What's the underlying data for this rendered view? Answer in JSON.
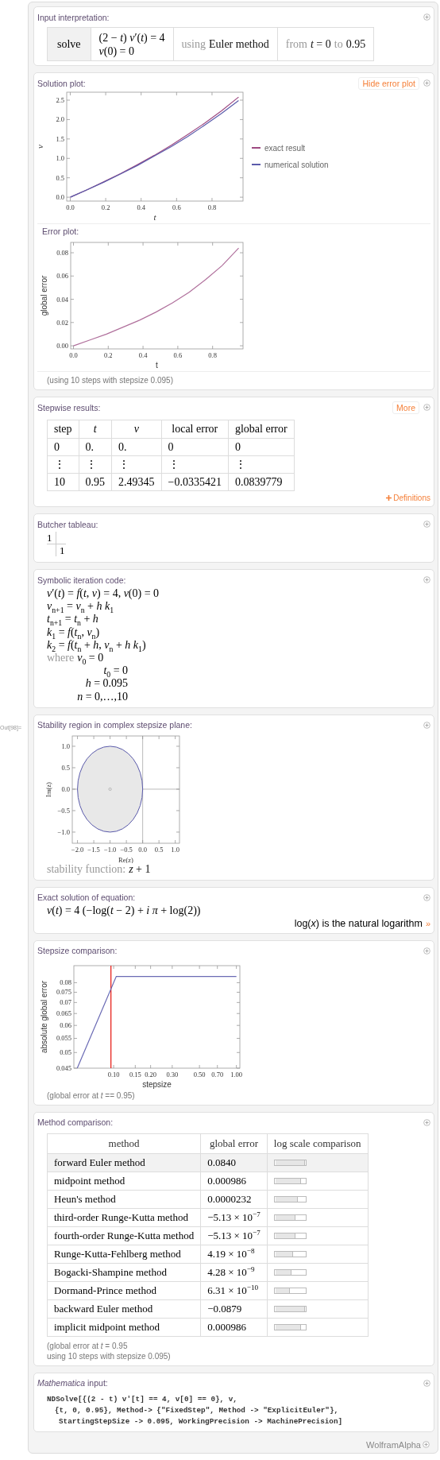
{
  "out_label": "Out[98]=",
  "input_interpretation": {
    "title": "Input interpretation:",
    "cells": [
      {
        "kind": "keyword",
        "lines": [
          "solve"
        ]
      },
      {
        "kind": "math",
        "lines": [
          "(2 − *t*) *v*′(*t*) = 4",
          "*v*(0) = 0"
        ]
      },
      {
        "kind": "segments",
        "segments": [
          {
            "text": "using",
            "muted": true
          },
          {
            "text": "Euler method",
            "muted": false
          }
        ]
      },
      {
        "kind": "segments",
        "segments": [
          {
            "text": "from",
            "muted": true
          },
          {
            "text": "*t* = 0",
            "muted": false
          },
          {
            "text": "to",
            "muted": true
          },
          {
            "text": "0.95",
            "muted": false
          }
        ]
      }
    ]
  },
  "solution_plot": {
    "title": "Solution plot:",
    "button": "Hide error plot",
    "chart_data": {
      "type": "line",
      "xlabel": "t",
      "ylabel": "v",
      "x": [
        0,
        0.095,
        0.19,
        0.285,
        0.38,
        0.475,
        0.57,
        0.665,
        0.76,
        0.855,
        0.95
      ],
      "series": [
        {
          "name": "exact result",
          "color": "#9e4a82",
          "values": [
            0,
            0.19,
            0.4,
            0.61,
            0.84,
            1.08,
            1.34,
            1.62,
            1.91,
            2.23,
            2.58
          ]
        },
        {
          "name": "numerical solution",
          "color": "#5b5bab",
          "values": [
            0,
            0.19,
            0.39,
            0.6,
            0.82,
            1.06,
            1.3,
            1.57,
            1.86,
            2.16,
            2.49
          ]
        }
      ],
      "xlim": [
        -0.02,
        0.975
      ],
      "ylim": [
        -0.1,
        2.705
      ],
      "xticks": [
        {
          "value": 0,
          "label": "0.0"
        },
        {
          "value": 0.2,
          "label": "0.2"
        },
        {
          "value": 0.4,
          "label": "0.4"
        },
        {
          "value": 0.6,
          "label": "0.6"
        },
        {
          "value": 0.8,
          "label": "0.8"
        }
      ],
      "yticks": [
        {
          "value": 0,
          "label": "0.0"
        },
        {
          "value": 0.5,
          "label": "0.5"
        },
        {
          "value": 1,
          "label": "1.0"
        },
        {
          "value": 1.5,
          "label": "1.5"
        },
        {
          "value": 2,
          "label": "2.0"
        },
        {
          "value": 2.5,
          "label": "2.5"
        }
      ]
    },
    "error_plot": {
      "title": "Error plot:",
      "chart_data": {
        "type": "line",
        "xlabel": "t",
        "ylabel": "global error",
        "x": [
          0,
          0.095,
          0.19,
          0.285,
          0.38,
          0.475,
          0.57,
          0.665,
          0.76,
          0.855,
          0.95
        ],
        "series": [
          {
            "color": "#b0709c",
            "values": [
              0,
              0.005,
              0.01,
              0.016,
              0.022,
              0.029,
              0.037,
              0.046,
              0.057,
              0.069,
              0.084
            ]
          }
        ],
        "xlim": [
          -0.016,
          0.975
        ],
        "ylim": [
          -0.0027,
          0.0889
        ],
        "xticks": [
          {
            "value": 0,
            "label": "0.0"
          },
          {
            "value": 0.2,
            "label": "0.2"
          },
          {
            "value": 0.4,
            "label": "0.4"
          },
          {
            "value": 0.6,
            "label": "0.6"
          },
          {
            "value": 0.8,
            "label": "0.8"
          }
        ],
        "yticks": [
          {
            "value": 0,
            "label": "0.00"
          },
          {
            "value": 0.02,
            "label": "0.02"
          },
          {
            "value": 0.04,
            "label": "0.04"
          },
          {
            "value": 0.06,
            "label": "0.06"
          },
          {
            "value": 0.08,
            "label": "0.08"
          }
        ]
      }
    },
    "note": "(using 10 steps with stepsize 0.095)"
  },
  "stepwise_results": {
    "title": "Stepwise results:",
    "button": "More",
    "columns": [
      "step",
      "*t*",
      "*v*",
      "local error",
      "global error"
    ],
    "rows": [
      [
        "0",
        "0.",
        "0.",
        "0",
        "0"
      ],
      [
        "⋮",
        "⋮",
        "⋮",
        "⋮",
        "⋮"
      ],
      [
        "10",
        "0.95",
        "2.49345",
        "−0.0335421",
        "0.0839779"
      ]
    ],
    "definitions_link": "Definitions"
  },
  "butcher_tableau": {
    "title": "Butcher tableau:",
    "c": "1",
    "b": "1"
  },
  "symbolic_iteration_code": {
    "title": "Symbolic iteration code:",
    "equations": [
      "*v*′(*t*) = *f*(*t*, *v*) = 4, *v*(0) = 0",
      "*v*$_{n+1}$ = *v*$_{n}$ + *h k*$_{1}$",
      "*t*$_{n+1}$ = *t*$_{n}$ + *h*",
      "*k*$_{1}$ = *f*(*t*$_{n}$, *v*$_{n}$)",
      "*k*$_{2}$ = *f*(*t*$_{n}$ + *h*, *v*$_{n}$ + *h k*$_{1}$)"
    ],
    "where_label": "where",
    "conditions": [
      "*v*$_{0}$ = 0",
      "*t*$_{0}$ = 0",
      "*h* = 0.095",
      "*n* = 0,…,10"
    ]
  },
  "stability_region": {
    "title": "Stability region in complex stepsize plane:",
    "xlabel": "Re(z)",
    "ylabel": "Im(z)",
    "xtick_labels": [
      "−2.0",
      "−1.5",
      "−1.0",
      "−0.5",
      "0.0",
      "0.5",
      "1.0"
    ],
    "ytick_labels": [
      "1.0",
      "0.5",
      "0.0",
      "−0.5",
      "−1.0"
    ],
    "caption": [
      {
        "text": "stability function:",
        "muted": true
      },
      {
        "text": "*z* + 1",
        "muted": false
      }
    ]
  },
  "exact_solution": {
    "title": "Exact solution of equation:",
    "equation": "*v*(*t*) = 4 (−log(*t* − 2) + *i π* + log(2))",
    "note": "log(*x*) is the natural logarithm",
    "note_arrow": "»"
  },
  "stepsize_comparison": {
    "title": "Stepsize comparison:",
    "plot": {
      "xlabel": "stepsize",
      "ylabel": "absolute global error",
      "xtick_labels": [
        "0.10",
        "0.15",
        "0.20",
        "0.30",
        "0.50",
        "0.70",
        "1.00"
      ],
      "ytick_labels": [
        "0.08",
        "0.075",
        "0.07",
        "0.065",
        "0.06",
        "0.055",
        "0.05",
        "0.045"
      ]
    },
    "note": "(global error at *t* == 0.95)"
  },
  "method_comparison": {
    "title": "Method comparison:",
    "columns": [
      "method",
      "global error",
      "log scale comparison"
    ],
    "rows": [
      {
        "method": "forward Euler method",
        "global_error": "0.0840",
        "level": 1.0,
        "highlighted": true
      },
      {
        "method": "midpoint method",
        "global_error": "0.000986",
        "level": 0.86,
        "highlighted": false
      },
      {
        "method": "Heun's method",
        "global_error": "0.0000232",
        "level": 0.76,
        "highlighted": false
      },
      {
        "method": "third-order Runge-Kutta method",
        "global_error": "−5.13 × 10$^{−7}$",
        "level": 0.67,
        "highlighted": false
      },
      {
        "method": "fourth-order Runge-Kutta method",
        "global_error": "−5.13 × 10$^{−7}$",
        "level": 0.67,
        "highlighted": false
      },
      {
        "method": "Runge-Kutta-Fehlberg method",
        "global_error": "4.19 × 10$^{−8}$",
        "level": 0.59,
        "highlighted": false
      },
      {
        "method": "Bogacki-Shampine method",
        "global_error": "4.28 × 10$^{−9}$",
        "level": 0.54,
        "highlighted": false
      },
      {
        "method": "Dormand-Prince method",
        "global_error": "6.31 × 10$^{−10}$",
        "level": 0.48,
        "highlighted": false
      },
      {
        "method": "backward Euler method",
        "global_error": "−0.0879",
        "level": 1.0,
        "highlighted": false
      },
      {
        "method": "implicit midpoint method",
        "global_error": "0.000986",
        "level": 0.86,
        "highlighted": false
      }
    ],
    "notes": [
      "(global error at *t* = 0.95",
      "using 10 steps with stepsize 0.095)"
    ]
  },
  "mathematica_input": {
    "title": "*Mathematica* input:",
    "lines": [
      "NDSolve[{(2 - t) v'[t] == 4, v[0] == 0}, v,",
      "{t, 0, 0.95}, Method-> {\"FixedStep\", Method -> \"ExplicitEuler\"},",
      "StartingStepSize -> 0.095, WorkingPrecision -> MachinePrecision]"
    ]
  },
  "footer": {
    "brand": "WolframAlpha"
  }
}
